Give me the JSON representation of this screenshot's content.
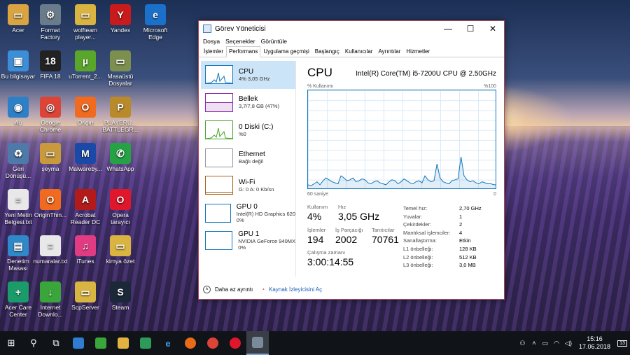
{
  "desktop": {
    "icons": [
      {
        "label": "Acer",
        "glyph": "▭",
        "color": "#d9a441"
      },
      {
        "label": "Format Factory",
        "glyph": "⚙",
        "color": "#6a7c8c"
      },
      {
        "label": "wolfteam player...",
        "glyph": "▭",
        "color": "#d9b441"
      },
      {
        "label": "Yandex",
        "glyph": "Y",
        "color": "#c91b1b"
      },
      {
        "label": "Microsoft Edge",
        "glyph": "e",
        "color": "#1b70c9"
      },
      {
        "label": "Bu bilgisayar",
        "glyph": "▣",
        "color": "#3c8ed6"
      },
      {
        "label": "FIFA 18",
        "glyph": "18",
        "color": "#222"
      },
      {
        "label": "uTorrent_2...",
        "glyph": "µ",
        "color": "#5aa62a"
      },
      {
        "label": "Masaüstü Dosyalar",
        "glyph": "▭",
        "color": "#7d8f4e"
      },
      {
        "label": "Ağ",
        "glyph": "◉",
        "color": "#2d7fc6"
      },
      {
        "label": "Google Chrome",
        "glyph": "◎",
        "color": "#db4437"
      },
      {
        "label": "Origin",
        "glyph": "O",
        "color": "#f06a1f"
      },
      {
        "label": "PLAYERU... BATTLEGR...",
        "glyph": "P",
        "color": "#b88a2a"
      },
      {
        "label": "Geri Dönüşü...",
        "glyph": "♻",
        "color": "#4d7aa8"
      },
      {
        "label": "şeyma",
        "glyph": "▭",
        "color": "#c99a3d"
      },
      {
        "label": "Malwareby...",
        "glyph": "M",
        "color": "#1a49a8"
      },
      {
        "label": "WhatsApp",
        "glyph": "✆",
        "color": "#25a244"
      },
      {
        "label": "Yeni Metin Belgesi.txt",
        "glyph": "≡",
        "color": "#e8e8e8"
      },
      {
        "label": "OriginThin...",
        "glyph": "O",
        "color": "#f06a1f"
      },
      {
        "label": "Acrobat Reader DC",
        "glyph": "A",
        "color": "#b31b1b"
      },
      {
        "label": "Opera tarayıcı",
        "glyph": "O",
        "color": "#e0162b"
      },
      {
        "label": "Denetim Masası",
        "glyph": "▤",
        "color": "#2f89c8"
      },
      {
        "label": "numaralar.txt",
        "glyph": "≡",
        "color": "#e8e8e8"
      },
      {
        "label": "iTunes",
        "glyph": "♫",
        "color": "#e03b83"
      },
      {
        "label": "kimya özet",
        "glyph": "▭",
        "color": "#d9b441"
      },
      {
        "label": "Acer Care Center",
        "glyph": "+",
        "color": "#1b9a6a"
      },
      {
        "label": "Internet Downlo...",
        "glyph": "↓",
        "color": "#3aa53a"
      },
      {
        "label": "ScpServer",
        "glyph": "▭",
        "color": "#d9b441"
      },
      {
        "label": "Steam",
        "glyph": "S",
        "color": "#1b2838"
      }
    ]
  },
  "window": {
    "title": "Görev Yöneticisi",
    "controls": {
      "minimize": "—",
      "maximize": "☐",
      "close": "✕"
    },
    "menu": [
      "Dosya",
      "Seçenekler",
      "Görüntüle"
    ],
    "tabs": [
      "İşlemler",
      "Performans",
      "Uygulama geçmişi",
      "Başlangıç",
      "Kullanıcılar",
      "Ayrıntılar",
      "Hizmetler"
    ],
    "selected_tab": "Performans",
    "sidebar": [
      {
        "title": "CPU",
        "sub": "4% 3,05 GHz",
        "color": "#1177bb"
      },
      {
        "title": "Bellek",
        "sub": "3,7/7,8 GB (47%)",
        "color": "#8b2aa6"
      },
      {
        "title": "0 Diski (C:)",
        "sub": "%0",
        "color": "#4aa52a"
      },
      {
        "title": "Ethernet",
        "sub": "Bağlı değil",
        "color": "#999999"
      },
      {
        "title": "Wi-Fi",
        "sub": "G: 0 A: 0 Kb/sn",
        "color": "#a8611a"
      },
      {
        "title": "GPU 0",
        "sub": "Intel(R) HD Graphics 620",
        "sub2": "0%",
        "color": "#1177bb"
      },
      {
        "title": "GPU 1",
        "sub": "NVIDIA GeForce 940MX",
        "sub2": "0%",
        "color": "#1177bb"
      }
    ],
    "cpu": {
      "title": "CPU",
      "model": "Intel(R) Core(TM) i5-7200U CPU @ 2.50GHz",
      "util_label": "% Kullanımı",
      "util_max": "%100",
      "axis_left": "60 saniye",
      "axis_right": "0",
      "usage_history": [
        5,
        4,
        6,
        8,
        5,
        9,
        12,
        10,
        8,
        7,
        6,
        14,
        12,
        9,
        10,
        12,
        8,
        9,
        11,
        10,
        7,
        6,
        8,
        9,
        7,
        6,
        5,
        8,
        10,
        9,
        6,
        8,
        11,
        9,
        7,
        6,
        8,
        9,
        7,
        14,
        10,
        8,
        9,
        26,
        12,
        8,
        7,
        6,
        9,
        10,
        11,
        33,
        14,
        10,
        8,
        9,
        7,
        6,
        8,
        7,
        6,
        6,
        5,
        5
      ],
      "stats": {
        "usage_label": "Kullanım",
        "usage": "4%",
        "speed_label": "Hız",
        "speed": "3,05 GHz",
        "processes_label": "İşlemler",
        "processes": "194",
        "threads_label": "İş Parçacığı",
        "threads": "2002",
        "handles_label": "Tanıtıcılar",
        "handles": "70761",
        "uptime_label": "Çalışma zamanı",
        "uptime": "3:00:14:55"
      },
      "specs": [
        {
          "k": "Temel hız:",
          "v": "2,70 GHz"
        },
        {
          "k": "Yuvalar:",
          "v": "1"
        },
        {
          "k": "Çekirdekler:",
          "v": "2"
        },
        {
          "k": "Mantıksal işlemciler:",
          "v": "4"
        },
        {
          "k": "Sanallaştırma:",
          "v": "Etkin"
        },
        {
          "k": "L1 önbelleği:",
          "v": "128 KB"
        },
        {
          "k": "L2 önbelleği:",
          "v": "512 KB"
        },
        {
          "k": "L3 önbelleği:",
          "v": "3,0 MB"
        }
      ]
    },
    "footer": {
      "less_details": "Daha az ayrıntı",
      "resource_monitor": "Kaynak İzleyicisini Aç"
    }
  },
  "taskbar": {
    "items": [
      {
        "name": "start-icon",
        "glyph": "⊞",
        "color": ""
      },
      {
        "name": "search-icon",
        "glyph": "⚲",
        "color": ""
      },
      {
        "name": "task-view-icon",
        "glyph": "⧉",
        "color": ""
      },
      {
        "name": "store-icon",
        "glyph": "",
        "color": "#2e7dd1"
      },
      {
        "name": "app-green-icon",
        "glyph": "",
        "color": "#3aa53a"
      },
      {
        "name": "explorer-icon",
        "glyph": "",
        "color": "#e3b341"
      },
      {
        "name": "app-green2-icon",
        "glyph": "",
        "color": "#2e9a5a"
      },
      {
        "name": "edge-icon",
        "glyph": "e",
        "color": ""
      },
      {
        "name": "firefox-icon",
        "glyph": "",
        "color": "#e86b1a"
      },
      {
        "name": "chrome-icon",
        "glyph": "",
        "color": "#db4437"
      },
      {
        "name": "opera-icon",
        "glyph": "",
        "color": "#e0162b"
      },
      {
        "name": "task-manager-icon",
        "glyph": "",
        "color": "#7a8a9a"
      }
    ],
    "time": "15:16",
    "date": "17.06.2018",
    "notifications": "13"
  }
}
